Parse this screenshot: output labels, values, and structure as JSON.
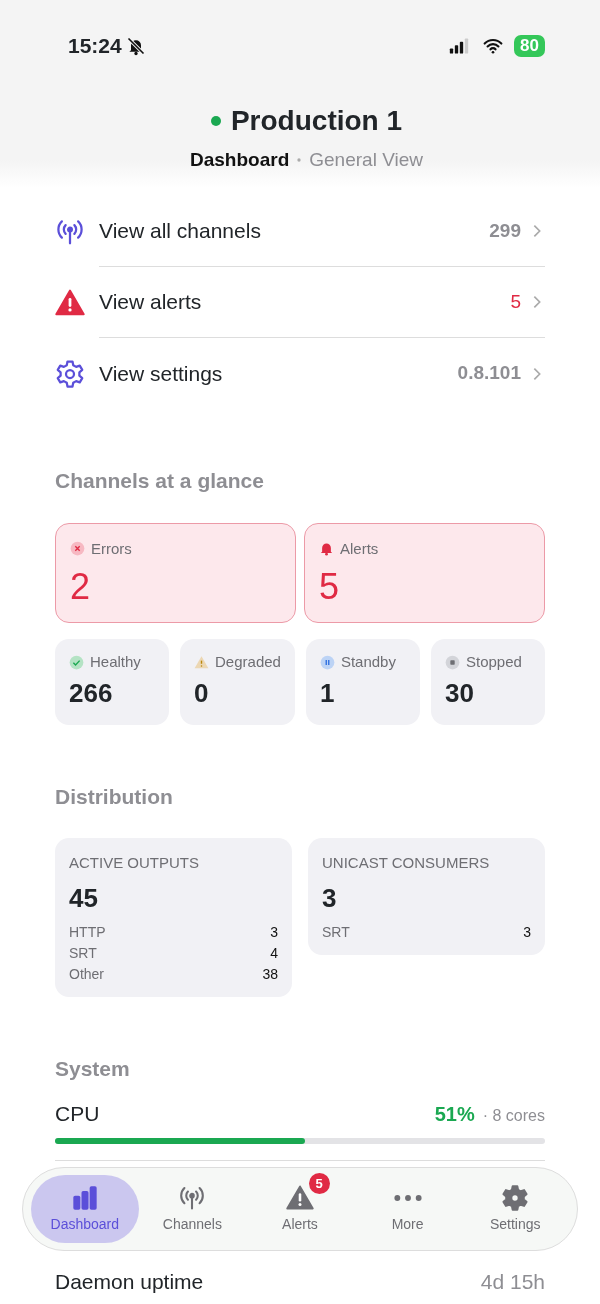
{
  "status_bar": {
    "time": "15:24",
    "silent": true,
    "battery": "80"
  },
  "header": {
    "title": "Production 1",
    "online": true,
    "breadcrumb": [
      {
        "label": "Dashboard",
        "selected": true
      },
      {
        "label": "General View",
        "selected": false
      }
    ]
  },
  "menu": [
    {
      "kind": "channels",
      "label": "View all channels",
      "value": "299",
      "alert": false
    },
    {
      "kind": "alerts",
      "label": "View alerts",
      "value": "5",
      "alert": true
    },
    {
      "kind": "settings",
      "label": "View settings",
      "value": "0.8.101",
      "alert": false
    }
  ],
  "glance": {
    "title": "Channels at a glance",
    "major": [
      {
        "kind": "error",
        "label": "Errors",
        "value": "2"
      },
      {
        "kind": "alert",
        "label": "Alerts",
        "value": "5"
      }
    ],
    "minor": [
      {
        "kind": "healthy",
        "label": "Healthy",
        "value": "266"
      },
      {
        "kind": "degraded",
        "label": "Degraded",
        "value": "0"
      },
      {
        "kind": "standby",
        "label": "Standby",
        "value": "1"
      },
      {
        "kind": "stopped",
        "label": "Stopped",
        "value": "30"
      }
    ]
  },
  "distribution": {
    "title": "Distribution",
    "cards": [
      {
        "title": "ACTIVE OUTPUTS",
        "value": "45",
        "rows": [
          {
            "label": "HTTP",
            "value": "3"
          },
          {
            "label": "SRT",
            "value": "4"
          },
          {
            "label": "Other",
            "value": "38"
          }
        ]
      },
      {
        "title": "UNICAST CONSUMERS",
        "value": "3",
        "rows": [
          {
            "label": "SRT",
            "value": "3"
          }
        ]
      }
    ]
  },
  "system": {
    "title": "System",
    "metrics": [
      {
        "label": "CPU",
        "reading": "51%",
        "detail": "· 8 cores",
        "level": 0.51
      }
    ],
    "uptime": {
      "label": "Daemon uptime",
      "value": "4d 15h"
    }
  },
  "tab_bar": [
    {
      "kind": "dashboard",
      "label": "Dashboard",
      "selected": true
    },
    {
      "kind": "channels",
      "label": "Channels",
      "selected": false
    },
    {
      "kind": "alerts",
      "label": "Alerts",
      "selected": false,
      "badge": "5"
    },
    {
      "kind": "more",
      "label": "More",
      "selected": false
    },
    {
      "kind": "settings",
      "label": "Settings",
      "selected": false
    }
  ]
}
